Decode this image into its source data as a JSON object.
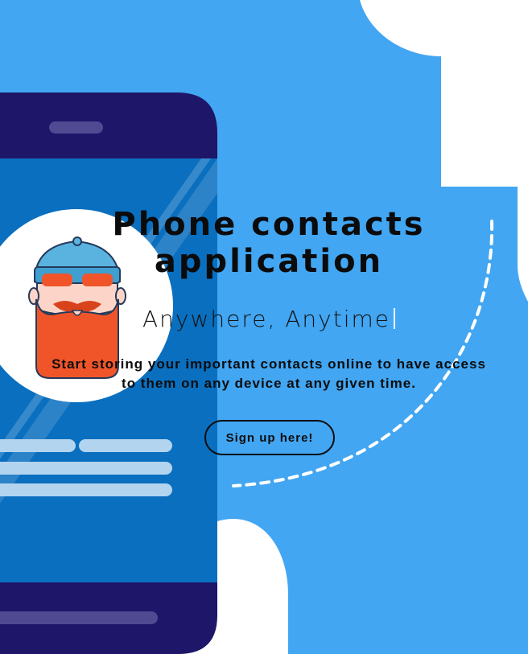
{
  "hero": {
    "title": "Phone contacts application",
    "tagline": "Anywhere, Anytime",
    "description": "Start storing your important contacts online to have access to them on any device at any given time.",
    "cta_label": "Sign up here!"
  },
  "illustration": {
    "phone": "smartphone-illustration",
    "avatar": "bearded-man-with-beanie-avatar",
    "colors": {
      "background": "#42a6f2",
      "phone_frame": "#1e1669",
      "phone_screen": "#0a6fbf",
      "avatar_circle": "#ffffff",
      "beard": "#f0552a",
      "beanie": "#5ab3df"
    }
  }
}
